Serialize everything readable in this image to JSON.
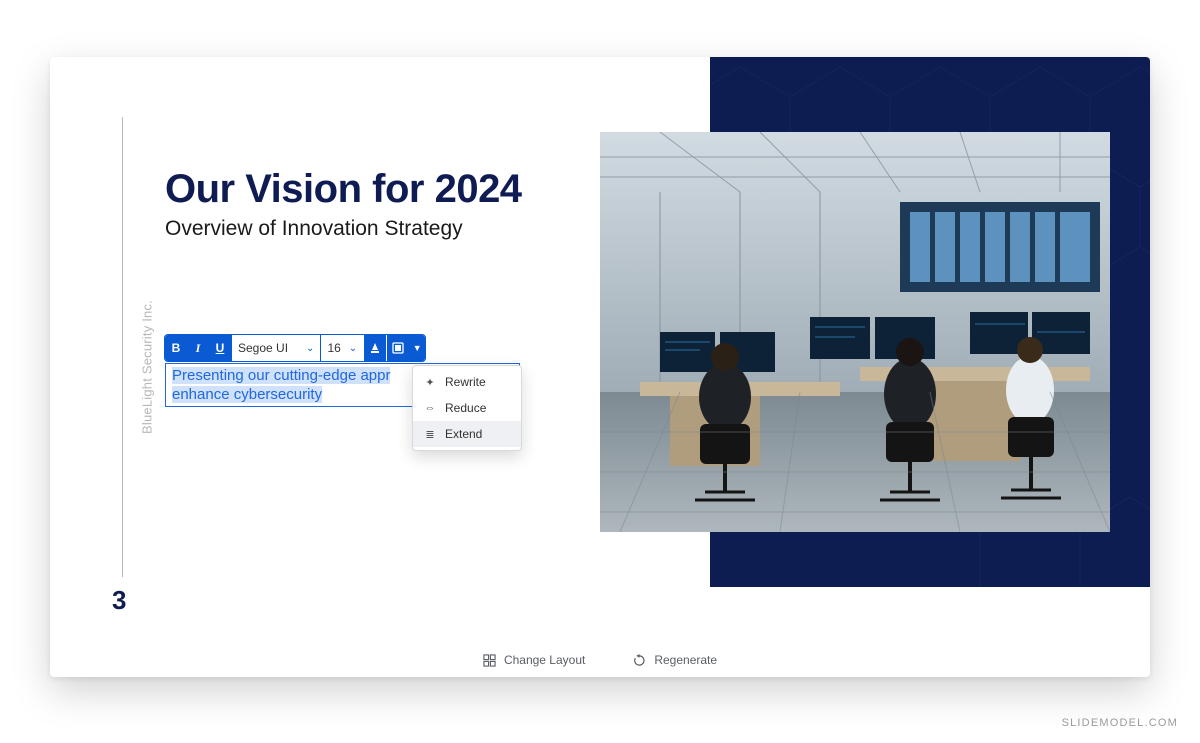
{
  "slide": {
    "company": "BlueLight Security Inc.",
    "title": "Our Vision for 2024",
    "subtitle": "Overview of Innovation Strategy",
    "slide_number": "3",
    "body_text_visible": "Presenting our cutting-edge appr",
    "body_text_line2": "enhance cybersecurity"
  },
  "toolbar": {
    "bold": "B",
    "italic": "I",
    "underline": "U",
    "font_name": "Segoe UI",
    "font_size": "16"
  },
  "ai_menu": {
    "items": [
      {
        "icon": "✦",
        "label": "Rewrite"
      },
      {
        "icon": "⇔",
        "label": "Reduce"
      },
      {
        "icon": "≣",
        "label": "Extend"
      }
    ]
  },
  "bottom": {
    "change_layout": "Change Layout",
    "regenerate": "Regenerate"
  },
  "watermark": "SLIDEMODEL.COM"
}
